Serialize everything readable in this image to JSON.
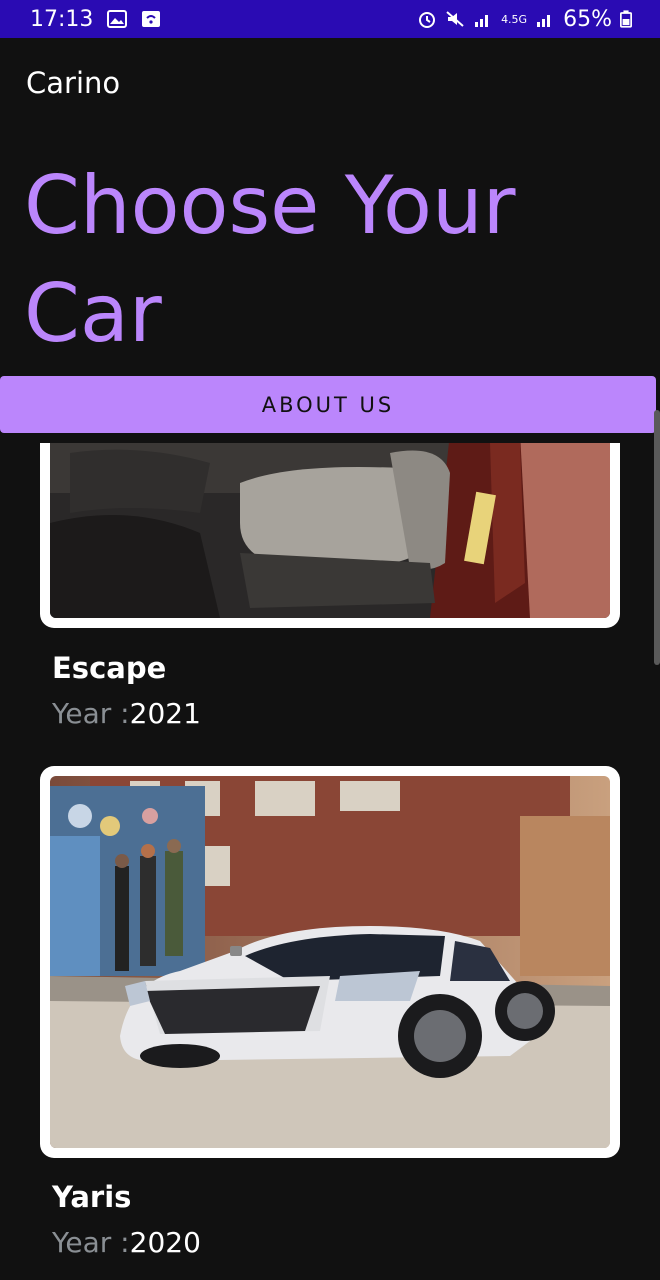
{
  "status_bar": {
    "time": "17:13",
    "network": "4.5G",
    "battery": "65%",
    "icons": [
      "gallery-icon",
      "screenshot-icon",
      "alarm-icon",
      "mute-icon",
      "signal-icon",
      "battery-icon"
    ]
  },
  "app": {
    "title": "Carino",
    "headline": "Choose Your Car",
    "about_button": "ABOUT US"
  },
  "cars": [
    {
      "name": "Escape",
      "year_label": "Year :",
      "year": "2021"
    },
    {
      "name": "Yaris",
      "year_label": "Year :",
      "year": "2020"
    }
  ],
  "colors": {
    "status_bar": "#2a0bb3",
    "background": "#111111",
    "accent": "#bb86fc",
    "secondary_text": "#8a8f94"
  }
}
